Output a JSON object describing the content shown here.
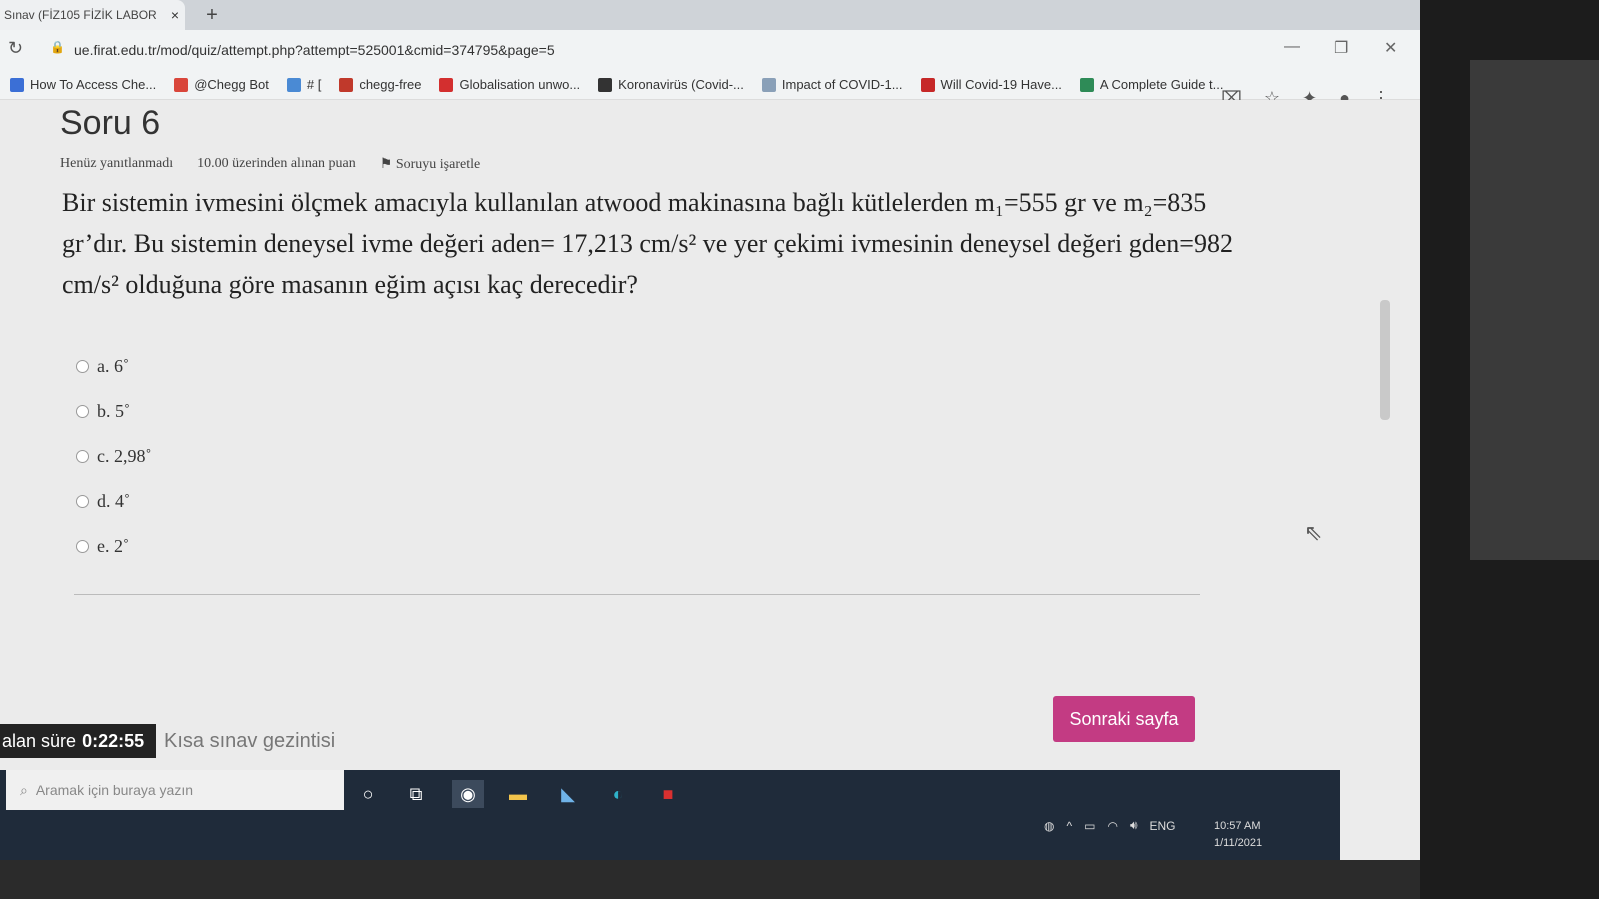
{
  "browser": {
    "tab_title": "Sınav (FİZ105 FİZİK LABOR",
    "tab_close": "×",
    "new_tab": "+",
    "url": "ue.firat.edu.tr/mod/quiz/attempt.php?attempt=525001&cmid=374795&page=5",
    "bookmarks": [
      {
        "label": "How To Access Che...",
        "icon_color": "#3b6fd6"
      },
      {
        "label": "@Chegg Bot",
        "icon_color": "#d9463b"
      },
      {
        "label": "# [",
        "icon_color": "#4a8ad4"
      },
      {
        "label": "chegg-free",
        "icon_color": "#c0392b"
      },
      {
        "label": "Globalisation unwo...",
        "icon_color": "#d32f2f"
      },
      {
        "label": "Koronavirüs (Covid-...",
        "icon_color": "#333333"
      },
      {
        "label": "Impact of COVID-1...",
        "icon_color": "#8aa0b8"
      },
      {
        "label": "Will Covid-19 Have...",
        "icon_color": "#c62828"
      },
      {
        "label": "A Complete Guide t...",
        "icon_color": "#2e8b57"
      }
    ],
    "overflow": "»"
  },
  "question": {
    "title": "Soru 6",
    "status": "Henüz yanıtlanmadı",
    "points": "10.00 üzerinden alınan puan",
    "flag_label": "Soruyu işaretle",
    "text": "Bir sistemin ivmesini ölçmek amacıyla kullanılan atwood makinasına bağlı kütlelerden m₁=555 gr ve m₂=835 gr’dır. Bu sistemin deneysel ivme değeri aden= 17,213 cm/s² ve yer çekimi ivmesinin deneysel değeri gden=982 cm/s² olduğuna göre masanın eğim açısı kaç derecedir?",
    "answers": [
      "a. 6˚",
      "b. 5˚",
      "c. 2,98˚",
      "d. 4˚",
      "e. 2˚"
    ]
  },
  "footer": {
    "next_button": "Sonraki sayfa",
    "timer_label": "alan süre",
    "timer_value": "0:22:55",
    "quiz_nav": "Kısa sınav gezintisi"
  },
  "taskbar": {
    "search_placeholder": "Aramak için buraya yazın",
    "lang": "ENG",
    "time": "10:57 AM",
    "date": "1/11/2021"
  }
}
